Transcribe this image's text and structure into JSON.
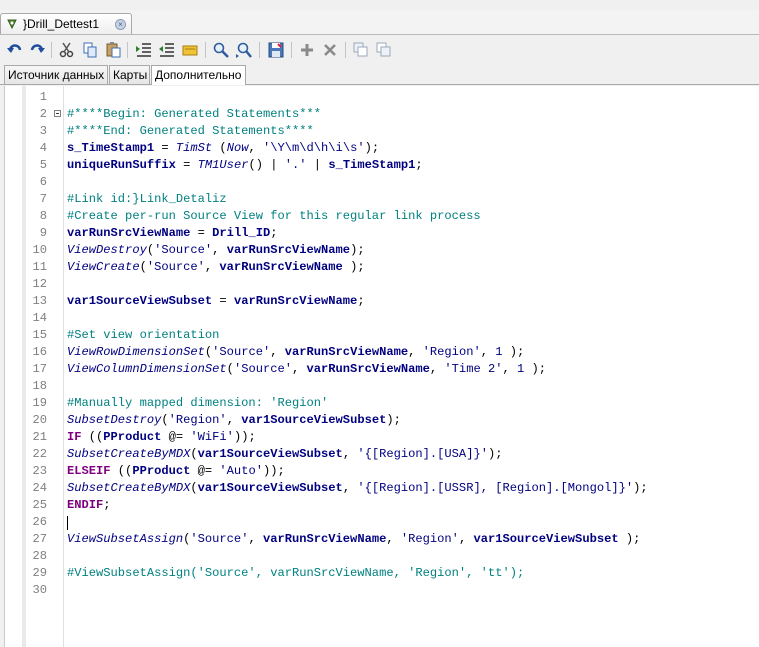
{
  "document_tab": {
    "title": "}Drill_Dettest1",
    "close_glyph": "×"
  },
  "toolbar": {
    "buttons": [
      "undo-icon",
      "redo-icon",
      "cut-icon",
      "copy-icon",
      "paste-icon",
      "indent-icon",
      "outdent-icon",
      "comment-icon",
      "find-icon",
      "find-next-icon",
      "save-icon",
      "add-icon",
      "delete-icon",
      "copy-window-icon",
      "paste-window-icon"
    ]
  },
  "subtabs": [
    "Источник данных",
    "Карты",
    "Дополнительно"
  ],
  "editor": {
    "lines": [
      {
        "n": "1",
        "tokens": []
      },
      {
        "n": "2",
        "fold": true,
        "tokens": [
          [
            "cm",
            "#****Begin: Generated Statements***"
          ]
        ]
      },
      {
        "n": "3",
        "tokens": [
          [
            "cm",
            "#****End: Generated Statements****"
          ]
        ]
      },
      {
        "n": "4",
        "tokens": [
          [
            "id",
            "s_TimeStamp1"
          ],
          [
            "op",
            " = "
          ],
          [
            "fn",
            "TimSt"
          ],
          [
            "op",
            " ("
          ],
          [
            "fn",
            "Now"
          ],
          [
            "op",
            ", "
          ],
          [
            "st",
            "'\\Y\\m\\d\\h\\i\\s'"
          ],
          [
            "op",
            ");"
          ]
        ]
      },
      {
        "n": "5",
        "tokens": [
          [
            "id",
            "uniqueRunSuffix"
          ],
          [
            "op",
            " = "
          ],
          [
            "fn",
            "TM1User"
          ],
          [
            "op",
            "() | "
          ],
          [
            "st",
            "'.'"
          ],
          [
            "op",
            " | "
          ],
          [
            "id",
            "s_TimeStamp1"
          ],
          [
            "op",
            ";"
          ]
        ]
      },
      {
        "n": "6",
        "tokens": []
      },
      {
        "n": "7",
        "tokens": [
          [
            "cm",
            "#Link id:}Link_Detaliz"
          ]
        ]
      },
      {
        "n": "8",
        "tokens": [
          [
            "cm",
            "#Create per-run Source View for this regular link process"
          ]
        ]
      },
      {
        "n": "9",
        "tokens": [
          [
            "id",
            "varRunSrcViewName"
          ],
          [
            "op",
            " = "
          ],
          [
            "id",
            "Drill_ID"
          ],
          [
            "op",
            ";"
          ]
        ]
      },
      {
        "n": "10",
        "tokens": [
          [
            "fn",
            "ViewDestroy"
          ],
          [
            "op",
            "("
          ],
          [
            "st",
            "'Source'"
          ],
          [
            "op",
            ", "
          ],
          [
            "id",
            "varRunSrcViewName"
          ],
          [
            "op",
            ");"
          ]
        ]
      },
      {
        "n": "11",
        "tokens": [
          [
            "fn",
            "ViewCreate"
          ],
          [
            "op",
            "("
          ],
          [
            "st",
            "'Source'"
          ],
          [
            "op",
            ", "
          ],
          [
            "id",
            "varRunSrcViewName"
          ],
          [
            "op",
            " );"
          ]
        ]
      },
      {
        "n": "12",
        "tokens": []
      },
      {
        "n": "13",
        "tokens": [
          [
            "id",
            "var1SourceViewSubset"
          ],
          [
            "op",
            " = "
          ],
          [
            "id",
            "varRunSrcViewName"
          ],
          [
            "op",
            ";"
          ]
        ]
      },
      {
        "n": "14",
        "tokens": []
      },
      {
        "n": "15",
        "tokens": [
          [
            "cm",
            "#Set view orientation"
          ]
        ]
      },
      {
        "n": "16",
        "tokens": [
          [
            "fn",
            "ViewRowDimensionSet"
          ],
          [
            "op",
            "("
          ],
          [
            "st",
            "'Source'"
          ],
          [
            "op",
            ", "
          ],
          [
            "id",
            "varRunSrcViewName"
          ],
          [
            "op",
            ", "
          ],
          [
            "st",
            "'Region'"
          ],
          [
            "op",
            ", "
          ],
          [
            "num",
            "1"
          ],
          [
            "op",
            " );"
          ]
        ]
      },
      {
        "n": "17",
        "tokens": [
          [
            "fn",
            "ViewColumnDimensionSet"
          ],
          [
            "op",
            "("
          ],
          [
            "st",
            "'Source'"
          ],
          [
            "op",
            ", "
          ],
          [
            "id",
            "varRunSrcViewName"
          ],
          [
            "op",
            ", "
          ],
          [
            "st",
            "'Time 2'"
          ],
          [
            "op",
            ", "
          ],
          [
            "num",
            "1"
          ],
          [
            "op",
            " );"
          ]
        ]
      },
      {
        "n": "18",
        "tokens": []
      },
      {
        "n": "19",
        "tokens": [
          [
            "cm",
            "#Manually mapped dimension: 'Region'"
          ]
        ]
      },
      {
        "n": "20",
        "tokens": [
          [
            "fn",
            "SubsetDestroy"
          ],
          [
            "op",
            "("
          ],
          [
            "st",
            "'Region'"
          ],
          [
            "op",
            ", "
          ],
          [
            "id",
            "var1SourceViewSubset"
          ],
          [
            "op",
            ");"
          ]
        ]
      },
      {
        "n": "21",
        "tokens": [
          [
            "kw",
            "IF"
          ],
          [
            "op",
            " (("
          ],
          [
            "id",
            "PProduct"
          ],
          [
            "op",
            " @= "
          ],
          [
            "st",
            "'WiFi'"
          ],
          [
            "op",
            "));"
          ]
        ]
      },
      {
        "n": "22",
        "tokens": [
          [
            "fn",
            "SubsetCreateByMDX"
          ],
          [
            "op",
            "("
          ],
          [
            "id",
            "var1SourceViewSubset"
          ],
          [
            "op",
            ", "
          ],
          [
            "st",
            "'{[Region].[USA]}'"
          ],
          [
            "op",
            ");"
          ]
        ]
      },
      {
        "n": "23",
        "tokens": [
          [
            "kw",
            "ELSEIF"
          ],
          [
            "op",
            " (("
          ],
          [
            "id",
            "PProduct"
          ],
          [
            "op",
            " @= "
          ],
          [
            "st",
            "'Auto'"
          ],
          [
            "op",
            "));"
          ]
        ]
      },
      {
        "n": "24",
        "tokens": [
          [
            "fn",
            "SubsetCreateByMDX"
          ],
          [
            "op",
            "("
          ],
          [
            "id",
            "var1SourceViewSubset"
          ],
          [
            "op",
            ", "
          ],
          [
            "st",
            "'{[Region].[USSR], [Region].[Mongol]}'"
          ],
          [
            "op",
            ");"
          ]
        ]
      },
      {
        "n": "25",
        "tokens": [
          [
            "kw",
            "ENDIF"
          ],
          [
            "op",
            ";"
          ]
        ]
      },
      {
        "n": "26",
        "caret": true,
        "tokens": []
      },
      {
        "n": "27",
        "tokens": [
          [
            "fn",
            "ViewSubsetAssign"
          ],
          [
            "op",
            "("
          ],
          [
            "st",
            "'Source'"
          ],
          [
            "op",
            ", "
          ],
          [
            "id",
            "varRunSrcViewName"
          ],
          [
            "op",
            ", "
          ],
          [
            "st",
            "'Region'"
          ],
          [
            "op",
            ", "
          ],
          [
            "id",
            "var1SourceViewSubset"
          ],
          [
            "op",
            " );"
          ]
        ]
      },
      {
        "n": "28",
        "tokens": []
      },
      {
        "n": "29",
        "tokens": [
          [
            "cm",
            "#ViewSubsetAssign('Source', varRunSrcViewName, 'Region', 'tt');"
          ]
        ]
      },
      {
        "n": "30",
        "tokens": []
      }
    ]
  }
}
